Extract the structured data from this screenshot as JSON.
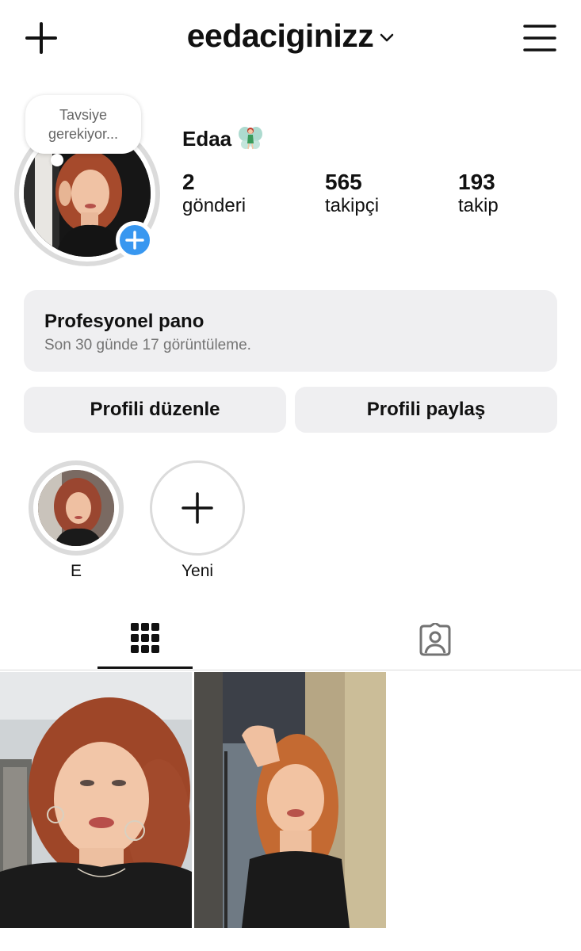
{
  "header": {
    "username": "eedaciginizz",
    "create_icon": "plus-icon",
    "dropdown_icon": "chevron-down-icon",
    "menu_icon": "hamburger-menu-icon"
  },
  "profile": {
    "note_bubble": "Tavsiye gerekiyor...",
    "display_name": "Edaa",
    "name_emoji": "🧚",
    "add_story_icon": "plus-icon",
    "stats": [
      {
        "value": "2",
        "label": "gönderi"
      },
      {
        "value": "565",
        "label": "takipçi"
      },
      {
        "value": "193",
        "label": "takip"
      }
    ]
  },
  "dashboard": {
    "title": "Profesyonel pano",
    "subtitle": "Son 30 günde 17 görüntüleme."
  },
  "buttons": {
    "edit": "Profili düzenle",
    "share": "Profili paylaş"
  },
  "highlights": [
    {
      "label": "E"
    },
    {
      "label": "Yeni"
    }
  ],
  "tabs": [
    {
      "icon": "grid-icon",
      "active": true
    },
    {
      "icon": "tagged-person-icon",
      "active": false
    }
  ],
  "colors": {
    "accent_blue": "#3897f0",
    "surface": "#efeff1",
    "secondary_text": "#737373",
    "border": "#dbdbdb"
  }
}
